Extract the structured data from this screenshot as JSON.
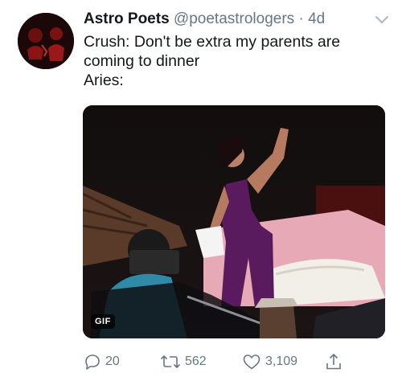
{
  "tweet": {
    "display_name": "Astro Poets",
    "handle": "@poetastrologers",
    "separator": "·",
    "timestamp": "4d",
    "text_lines": [
      "Crush: Don't be extra my parents are",
      "coming to dinner",
      "Aries:"
    ],
    "media": {
      "badge": "GIF"
    },
    "actions": {
      "reply_count": "20",
      "retweet_count": "562",
      "like_count": "3,109"
    }
  },
  "icons": {
    "menu": "chevron-down-icon",
    "reply": "reply-icon",
    "retweet": "retweet-icon",
    "like": "heart-icon",
    "share": "share-icon"
  },
  "colors": {
    "text": "#14171a",
    "secondary": "#657786"
  }
}
